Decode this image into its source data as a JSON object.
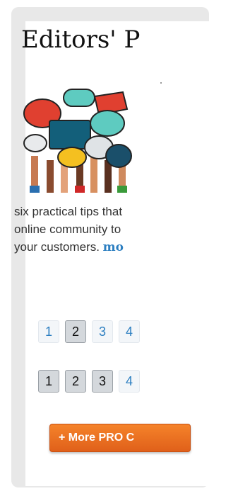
{
  "widget": {
    "title": "Editors' P",
    "blurb_lines": [
      "six practical tips that",
      "online community to",
      "your customers. "
    ],
    "more_label": "mo"
  },
  "pagination_1": [
    {
      "label": "1",
      "style": "link"
    },
    {
      "label": "2",
      "style": "active"
    },
    {
      "label": "3",
      "style": "link"
    },
    {
      "label": "4",
      "style": "link"
    }
  ],
  "pagination_2": [
    {
      "label": "1",
      "style": "dark"
    },
    {
      "label": "2",
      "style": "dark"
    },
    {
      "label": "3",
      "style": "dark"
    },
    {
      "label": "4",
      "style": "link"
    }
  ],
  "more_pro_button": "+ More PRO C",
  "colors": {
    "link": "#2d7fc1",
    "button_orange": "#f07525",
    "frame": "#e8e8e8"
  },
  "icons": {
    "thumbnail": "speech-bubbles-hands-illustration"
  }
}
